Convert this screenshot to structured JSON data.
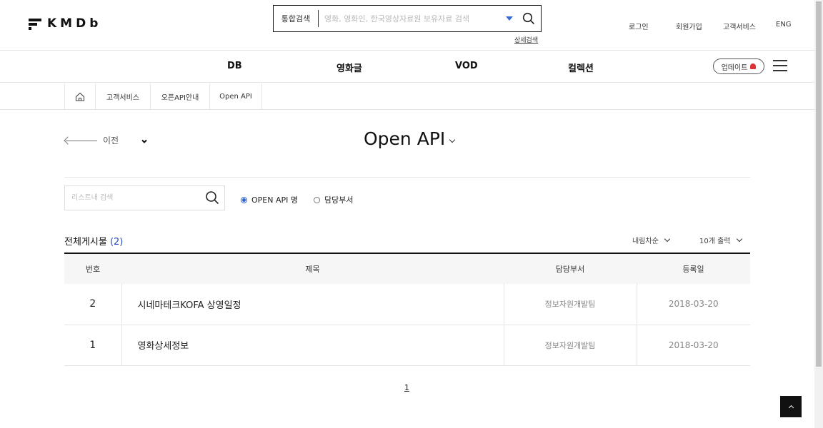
{
  "header": {
    "logo_text": "KMDb",
    "search": {
      "category": "통합검색",
      "placeholder": "영화, 영화인, 한국영상자료원 보유자료 검색",
      "advanced": "상세검색"
    },
    "links": [
      "로그인",
      "회원가입",
      "고객서비스",
      "ENG"
    ]
  },
  "nav": {
    "items": [
      "DB",
      "영화글",
      "VOD",
      "컬렉션"
    ],
    "update_label": "업데이트"
  },
  "breadcrumb": [
    "고객서비스",
    "오픈API안내",
    "Open API"
  ],
  "page": {
    "prev_label": "이전",
    "title": "Open API",
    "list_search_placeholder": "리스트내 검색",
    "radios": [
      {
        "label": "OPEN API 명",
        "checked": true
      },
      {
        "label": "담당부서",
        "checked": false
      }
    ],
    "total_label": "전체게시물",
    "total_count": "(2)",
    "sort_order": "내림차순",
    "page_size": "10개 출력"
  },
  "table": {
    "headers": [
      "번호",
      "제목",
      "담당부서",
      "등록일"
    ],
    "rows": [
      {
        "num": "2",
        "title": "시네마테크KOFA 상영일정",
        "dept": "정보자원개발팀",
        "date": "2018-03-20"
      },
      {
        "num": "1",
        "title": "영화상세정보",
        "dept": "정보자원개발팀",
        "date": "2018-03-20"
      }
    ]
  },
  "pagination": {
    "current": "1"
  },
  "colors": {
    "accent": "#2a61d8",
    "dark": "#111111"
  }
}
